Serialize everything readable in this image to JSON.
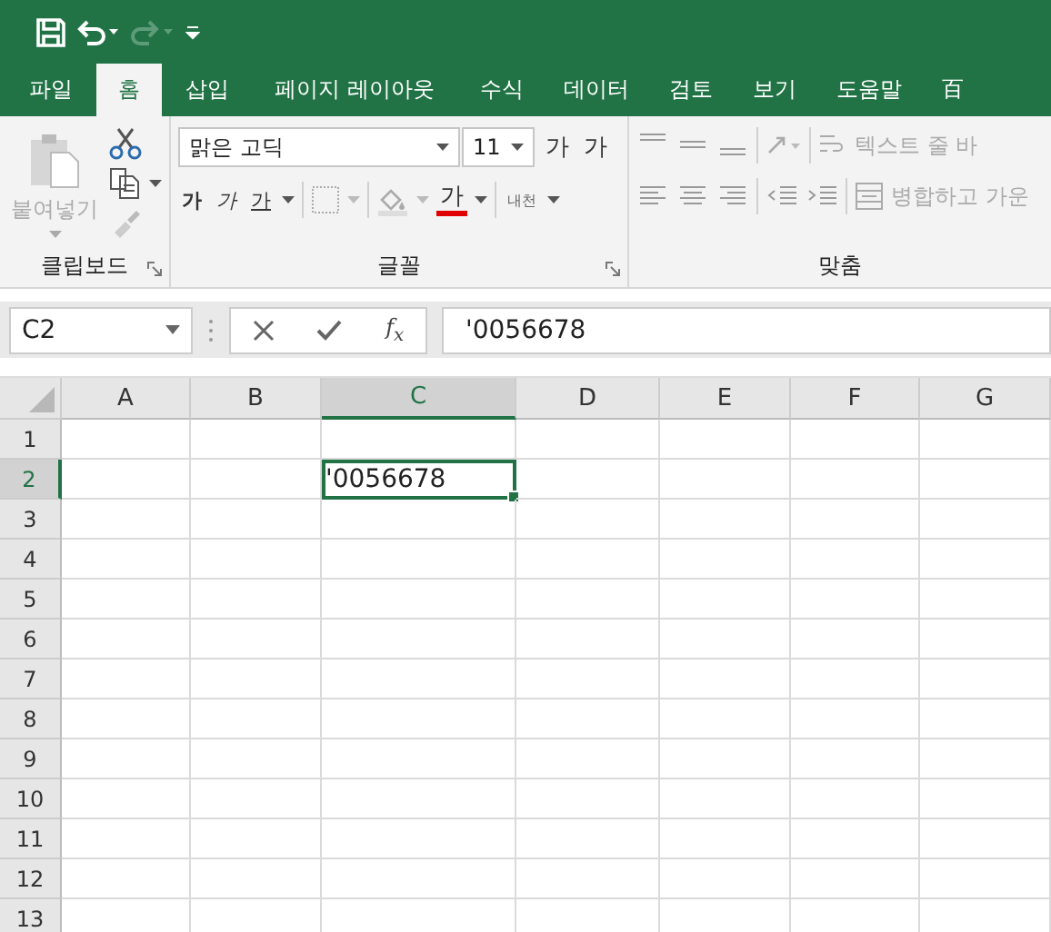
{
  "quick_access": [
    {
      "kind": "save",
      "disabled": false
    },
    {
      "kind": "undo",
      "disabled": false
    },
    {
      "kind": "redo",
      "disabled": true
    },
    {
      "kind": "customize",
      "disabled": false
    }
  ],
  "tabs": [
    {
      "label": "파일",
      "selected": false
    },
    {
      "label": "홈",
      "selected": true
    },
    {
      "label": "삽입",
      "selected": false
    },
    {
      "label": "페이지 레이아웃",
      "selected": false
    },
    {
      "label": "수식",
      "selected": false
    },
    {
      "label": "데이터",
      "selected": false
    },
    {
      "label": "검토",
      "selected": false
    },
    {
      "label": "보기",
      "selected": false
    },
    {
      "label": "도움말",
      "selected": false
    },
    {
      "label": "百",
      "selected": false
    }
  ],
  "ribbon": {
    "clipboard": {
      "paste_label": "붙여넣기",
      "group_label": "클립보드"
    },
    "font": {
      "name": "맑은 고딕",
      "size": "11",
      "grow": "가",
      "shrink": "가",
      "bold": "가",
      "italic": "가",
      "underline": "가",
      "font_color": "가",
      "phonetic": "내천",
      "group_label": "글꼴"
    },
    "alignment": {
      "wrap_text": "텍스트 줄 바",
      "merge": "병합하고 가운",
      "group_label": "맞춤"
    }
  },
  "formula_bar": {
    "name_box": "C2",
    "fx": "f$_{x}$",
    "formula": "'0056678"
  },
  "sheet": {
    "columns": [
      {
        "label": "A",
        "selected": false
      },
      {
        "label": "B",
        "selected": false
      },
      {
        "label": "C",
        "selected": true
      },
      {
        "label": "D",
        "selected": false
      },
      {
        "label": "E",
        "selected": false
      },
      {
        "label": "F",
        "selected": false
      },
      {
        "label": "G",
        "selected": false
      }
    ],
    "rows": [
      {
        "label": "1",
        "selected": false,
        "cells": []
      },
      {
        "label": "2",
        "selected": true,
        "cells": [
          "",
          "",
          "'0056678"
        ]
      },
      {
        "label": "3",
        "selected": false,
        "cells": []
      },
      {
        "label": "4",
        "selected": false,
        "cells": []
      },
      {
        "label": "5",
        "selected": false,
        "cells": []
      },
      {
        "label": "6",
        "selected": false,
        "cells": []
      },
      {
        "label": "7",
        "selected": false,
        "cells": []
      },
      {
        "label": "8",
        "selected": false,
        "cells": []
      },
      {
        "label": "9",
        "selected": false,
        "cells": []
      },
      {
        "label": "10",
        "selected": false,
        "cells": []
      },
      {
        "label": "11",
        "selected": false,
        "cells": []
      },
      {
        "label": "12",
        "selected": false,
        "cells": []
      },
      {
        "label": "13",
        "selected": false,
        "cells": []
      }
    ]
  }
}
